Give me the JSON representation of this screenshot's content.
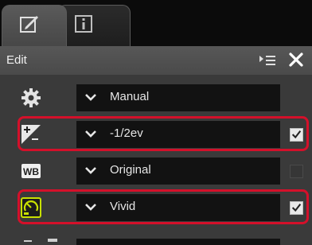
{
  "tabs": [
    {
      "label": "",
      "icon": "edit-icon",
      "active": true
    },
    {
      "label": "",
      "icon": "info-icon",
      "active": false
    }
  ],
  "header": {
    "title": "Edit",
    "menu_icon": "panel-menu-icon",
    "close_icon": "close-icon"
  },
  "rows": [
    {
      "name": "picture-control-mode",
      "icon": "gear-icon",
      "value": "Manual",
      "checkbox": "none",
      "highlighted": false
    },
    {
      "name": "exposure-compensation",
      "icon": "exposure-compensation-icon",
      "value": "-1/2ev",
      "checkbox": "checked",
      "highlighted": true
    },
    {
      "name": "white-balance",
      "icon": "wb-icon",
      "icon_text": "WB",
      "value": "Original",
      "checkbox": "disabled",
      "highlighted": false
    },
    {
      "name": "picture-control",
      "icon": "picture-control-icon",
      "value": "Vivid",
      "checkbox": "checked",
      "highlighted": true
    }
  ],
  "colors": {
    "panel_bg": "#3c3c3c",
    "field_bg": "#121212",
    "text": "#e6e6e6",
    "highlight_border": "#d4102a",
    "picture_control_icon": "#c8e000"
  }
}
